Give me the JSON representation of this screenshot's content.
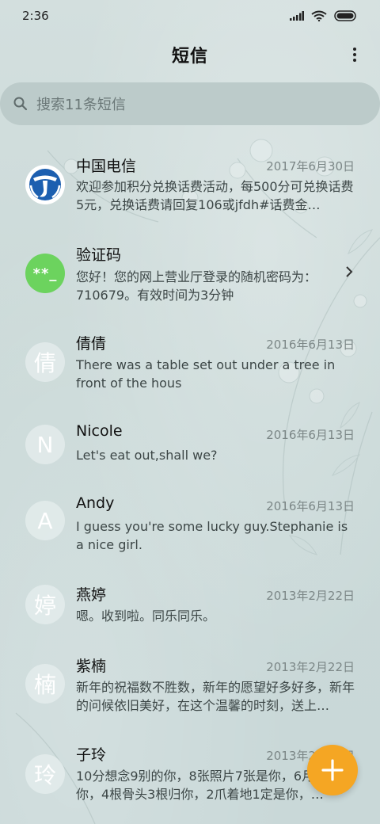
{
  "status_bar": {
    "time": "2:36"
  },
  "header": {
    "title": "短信"
  },
  "search": {
    "placeholder": "搜索11条短信"
  },
  "conversations": [
    {
      "name": "中国电信",
      "date": "2017年6月30日",
      "preview": "欢迎参加积分兑换话费活动，每500分可兑换话费5元，兑换话费请回复106或jfdh#话费金…",
      "avatar": "telecom-logo"
    },
    {
      "name": "验证码",
      "date": "",
      "preview": "您好！您的网上营业厅登录的随机密码为：710679。有效时间为3分钟",
      "avatar_text": "**_"
    },
    {
      "name": "倩倩",
      "date": "2016年6月13日",
      "preview": "There was a table set out under a tree in front of the hous",
      "avatar_text": "倩"
    },
    {
      "name": "Nicole",
      "date": "2016年6月13日",
      "preview": "Let's eat out,shall we?",
      "avatar_text": "N"
    },
    {
      "name": "Andy",
      "date": "2016年6月13日",
      "preview": "I guess you're some lucky guy.Stephanie is a nice girl.",
      "avatar_text": "A"
    },
    {
      "name": "燕婷",
      "date": "2013年2月22日",
      "preview": "嗯。收到啦。同乐同乐。",
      "avatar_text": "婷"
    },
    {
      "name": "紫楠",
      "date": "2013年2月22日",
      "preview": "新年的祝福数不胜数，新年的愿望好多好多，新年的问候依旧美好，在这个温馨的时刻，送上…",
      "avatar_text": "楠"
    },
    {
      "name": "子玲",
      "date": "2013年2月22日",
      "preview": "10分想念9别的你，8张照片7张是你，6月只像你，4根骨头3根归你，2爪着地1定是你，…",
      "avatar_text": "玲"
    }
  ],
  "colors": {
    "fab": "#f5a623",
    "verify_avatar": "#6cd35e",
    "telecom_blue": "#1c5fb0"
  },
  "icons": {
    "search": "search-icon",
    "more": "more-vert-icon",
    "fab": "plus-icon",
    "chevron": "chevron-right-icon"
  }
}
